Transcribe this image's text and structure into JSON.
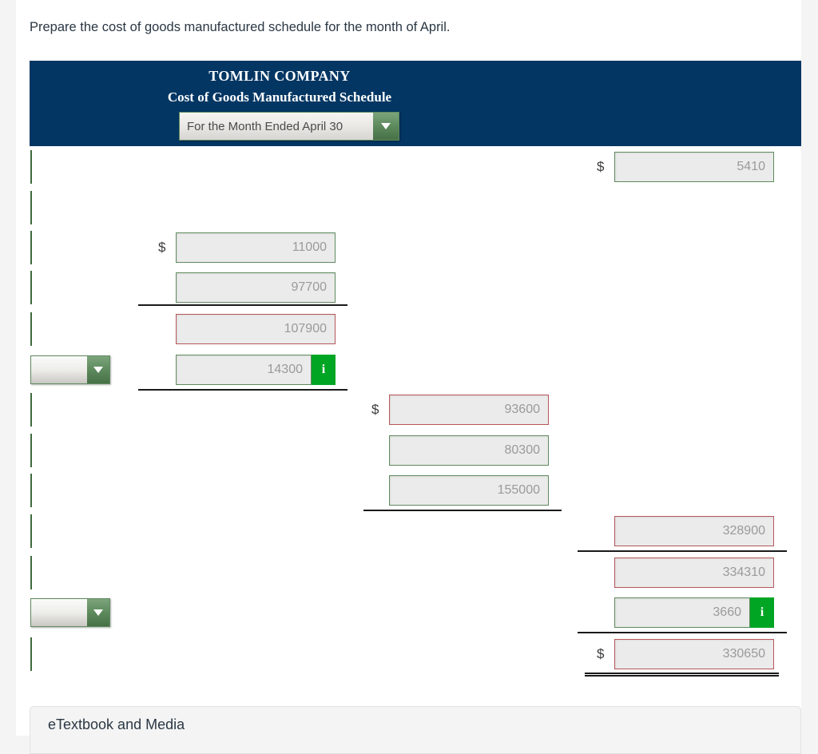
{
  "instruction": "Prepare the cost of goods manufactured schedule for the month of April.",
  "schedule": {
    "company": "TOMLIN COMPANY",
    "title": "Cost of Goods Manufactured Schedule",
    "period_select": {
      "value": "For the Month Ended April 30",
      "caret_icon": "chevron-down-icon"
    }
  },
  "colors": {
    "header_navy": "#033663",
    "border_valid": "#5f8a5f",
    "border_invalid": "#b5565b",
    "info_green": "#00a524",
    "field_fill": "#ebebeb",
    "value_text": "#9a9a9a"
  },
  "currency_symbol": "$",
  "info_icon_label": "i",
  "rows": [
    {
      "id": "r1",
      "col": "d",
      "value": "5410",
      "state": "ok",
      "dollar": true,
      "info": false
    },
    {
      "id": "r2",
      "col": "none"
    },
    {
      "id": "r3",
      "col": "b",
      "value": "11000",
      "state": "ok",
      "dollar": true,
      "info": false
    },
    {
      "id": "r4",
      "col": "b",
      "value": "97700",
      "state": "ok",
      "dollar": false,
      "info": false
    },
    {
      "id": "r5",
      "col": "b",
      "value": "107900",
      "state": "err",
      "dollar": false,
      "info": false
    },
    {
      "id": "r6",
      "col": "b",
      "value": "14300",
      "state": "ok",
      "dollar": false,
      "info": true
    },
    {
      "id": "r7",
      "col": "c",
      "value": "93600",
      "state": "err",
      "dollar": true,
      "info": false
    },
    {
      "id": "r8",
      "col": "c",
      "value": "80300",
      "state": "ok",
      "dollar": false,
      "info": false
    },
    {
      "id": "r9",
      "col": "c",
      "value": "155000",
      "state": "ok",
      "dollar": false,
      "info": false
    },
    {
      "id": "r10",
      "col": "d",
      "value": "328900",
      "state": "err",
      "dollar": false,
      "info": false
    },
    {
      "id": "r11",
      "col": "d",
      "value": "334310",
      "state": "err",
      "dollar": false,
      "info": false
    },
    {
      "id": "r12",
      "col": "d",
      "value": "3660",
      "state": "ok",
      "dollar": false,
      "info": true
    },
    {
      "id": "r13",
      "col": "d",
      "value": "330650",
      "state": "err",
      "dollar": true,
      "info": false
    }
  ],
  "etextbook": {
    "label": "eTextbook and Media"
  }
}
